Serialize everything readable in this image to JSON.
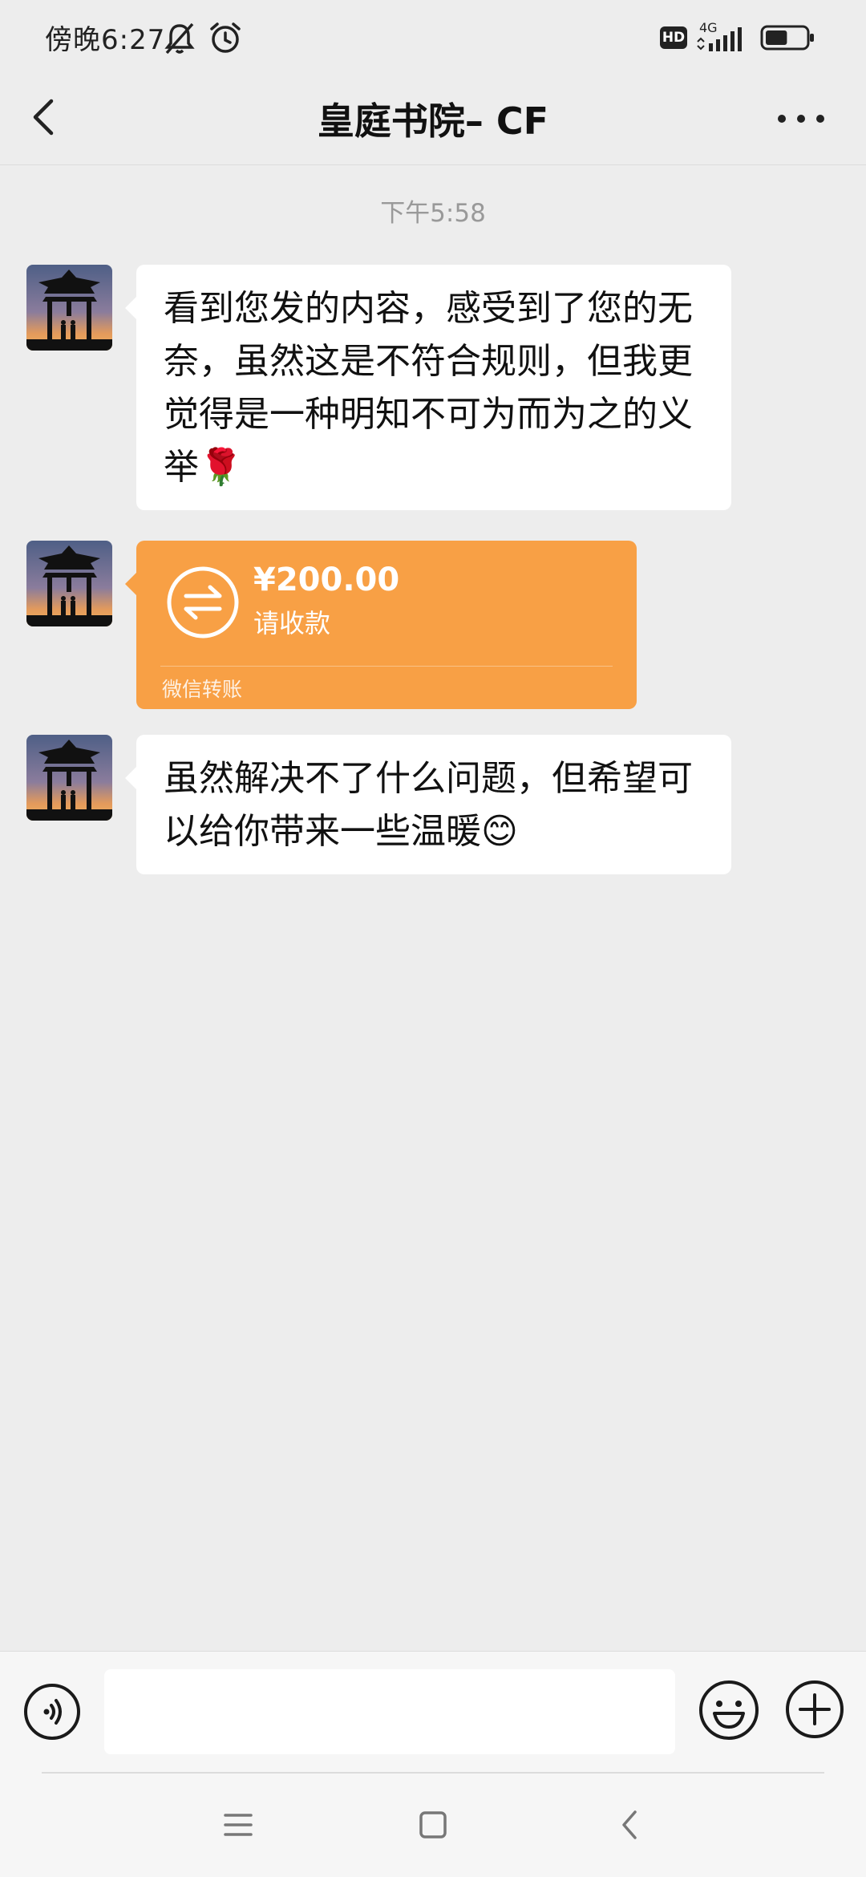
{
  "status_bar": {
    "time": "傍晚6:27",
    "hd_label": "HD",
    "network": "4G",
    "battery_level": 0.55
  },
  "header": {
    "title": "皇庭书院– CF"
  },
  "messages": [
    {
      "type": "timestamp",
      "text": "下午5:58"
    },
    {
      "type": "text",
      "text": "看到您发的内容，感受到了您的无奈，虽然这是不符合规则，但我更觉得是一种明知不可为而为之的义举",
      "emoji": "🌹"
    },
    {
      "type": "transfer",
      "amount": "¥200.00",
      "status": "请收款",
      "label": "微信转账"
    },
    {
      "type": "text",
      "text": "虽然解决不了什么问题，但希望可以给你带来一些温暖",
      "emoji": "😊"
    }
  ],
  "colors": {
    "background": "#ededed",
    "bubble": "#ffffff",
    "transfer": "#f8a045"
  },
  "icons": {
    "back": "chevron-left-icon",
    "more": "more-dots-icon",
    "voice": "voice-icon",
    "emoji": "smiley-icon",
    "plus": "plus-icon",
    "transfer": "transfer-arrows-icon"
  }
}
